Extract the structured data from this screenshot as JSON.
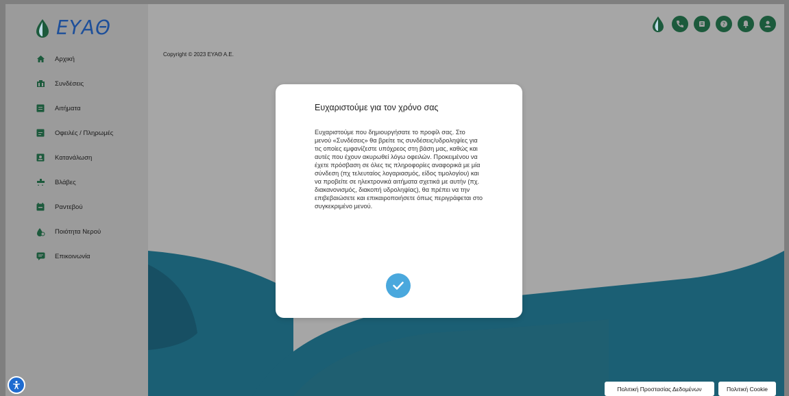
{
  "app": {
    "logo_text": "ΕΥΑΘ"
  },
  "sidebar": {
    "items": [
      {
        "label": "Αρχική",
        "icon": "home-icon"
      },
      {
        "label": "Συνδέσεις",
        "icon": "connections-icon"
      },
      {
        "label": "Αιτήματα",
        "icon": "requests-icon"
      },
      {
        "label": "Οφειλές / Πληρωμές",
        "icon": "payments-icon"
      },
      {
        "label": "Κατανάλωση",
        "icon": "consumption-icon"
      },
      {
        "label": "Βλάβες",
        "icon": "damages-icon"
      },
      {
        "label": "Ραντεβού",
        "icon": "appointments-icon"
      },
      {
        "label": "Ποιότητα Νερού",
        "icon": "water-quality-icon"
      },
      {
        "label": "Επικοινωνία",
        "icon": "contact-icon"
      }
    ]
  },
  "main": {
    "copyright": "Copyright © 2023 ΕΥΑΘ Α.Ε."
  },
  "header": {
    "icons": [
      "water-drop-icon",
      "phone-icon",
      "guide-icon",
      "help-icon",
      "notifications-icon",
      "user-icon"
    ]
  },
  "modal": {
    "title": "Ευχαριστούμε για τον χρόνο σας",
    "body": "Ευχαριστούμε που δημιουργήσατε το προφίλ σας. Στο μενού «Συνδέσεις» θα βρείτε τις συνδέσεις/υδροληψίες για τις οποίες εμφανίζεστε υπόχρεος στη βάση μας, καθώς και αυτές που έχουν ακυρωθεί λόγω οφειλών. Προκειμένου να έχετε πρόσβαση σε όλες τις πληροφορίες αναφορικά με μία σύνδεση (πχ τελευταίος λογαριασμός, είδος τιμολογίου) και να προβείτε σε ηλεκτρονικά αιτήματα σχετικά με αυτήν (πχ. διακανονισμός, διακοπή υδροληψίας), θα πρέπει να την επιβεβαιώσετε και επικαιροποιήσετε όπως περιγράφεται στο συγκεκριμένο μενού."
  },
  "footer": {
    "privacy_label": "Πολιτική Προστασίας Δεδομένων",
    "cookie_label": "Πολιτική Cookie"
  },
  "colors": {
    "accent": "#4aa8dd",
    "brand": "#1d4f9a",
    "wave": "#1b5f74",
    "icon_green": "#1c5a3c"
  }
}
